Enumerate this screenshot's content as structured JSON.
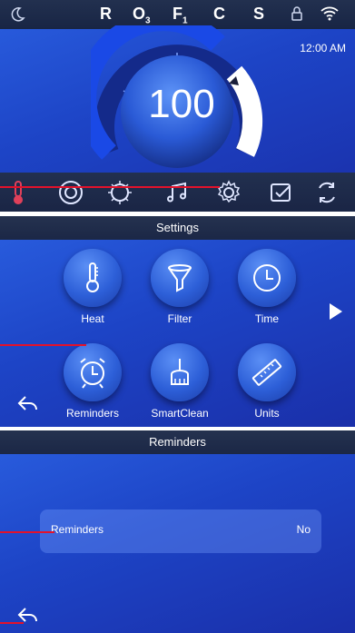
{
  "status": {
    "letters": [
      {
        "main": "R",
        "sub": ""
      },
      {
        "main": "O",
        "sub": "3"
      },
      {
        "main": "F",
        "sub": "1"
      },
      {
        "main": "C",
        "sub": ""
      },
      {
        "main": "S",
        "sub": ""
      }
    ],
    "time": "12:00 AM"
  },
  "gauge": {
    "temperature": "100"
  },
  "nav": [
    "thermometer-icon",
    "pump-icon",
    "light-icon",
    "music-icon",
    "settings-icon",
    "check-icon",
    "refresh-icon"
  ],
  "settings": {
    "title": "Settings",
    "tiles": [
      {
        "label": "Heat",
        "icon": "thermometer-icon"
      },
      {
        "label": "Filter",
        "icon": "filter-icon"
      },
      {
        "label": "Time",
        "icon": "clock-icon"
      },
      {
        "label": "Reminders",
        "icon": "alarm-icon"
      },
      {
        "label": "SmartClean",
        "icon": "broom-icon"
      },
      {
        "label": "Units",
        "icon": "ruler-icon"
      }
    ]
  },
  "reminders": {
    "title": "Reminders",
    "row_label": "Reminders",
    "row_value": "No"
  },
  "colors": {
    "callout": "#e3122b",
    "accent": "#1d44c6"
  }
}
